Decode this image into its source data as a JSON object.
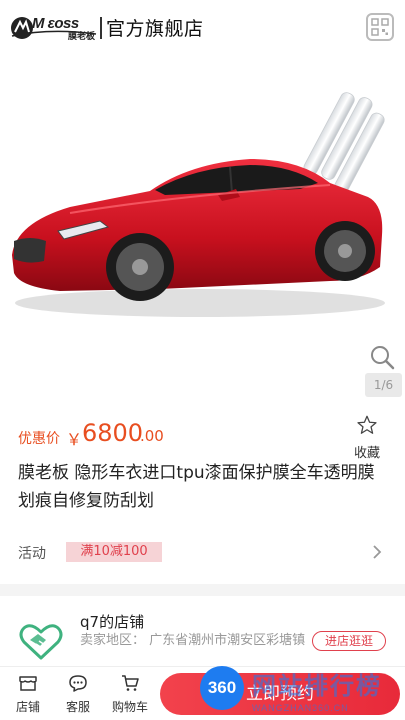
{
  "header": {
    "logo_text": "M ɛoss",
    "logo_sub": "膜老板",
    "title": "官方旗舰店",
    "qr_icon": "qr-code-icon"
  },
  "gallery": {
    "image": "red-sports-car-with-film-rolls",
    "page_indicator": "1/6",
    "zoom_icon": "search-icon"
  },
  "price": {
    "label": "优惠价",
    "currency": "￥",
    "integer": "6800",
    "decimal": ".00",
    "color": "#e84e20"
  },
  "favorite": {
    "label": "收藏",
    "icon": "star-icon"
  },
  "product_title": "膜老板 隐形车衣进口tpu漆面保护膜全车透明膜划痕自修复防刮划",
  "activity": {
    "label": "活动",
    "badge": "满10减100",
    "chevron_icon": "chevron-right-icon"
  },
  "store": {
    "name": "q7的店铺",
    "location": "卖家地区： 广东省潮州市潮安区彩塘镇",
    "visit_label": "进店逛逛",
    "logo_icon": "handshake-heart-icon"
  },
  "bottom_nav": {
    "items": [
      {
        "label": "店铺",
        "icon": "store-icon"
      },
      {
        "label": "客服",
        "icon": "chat-icon"
      },
      {
        "label": "购物车",
        "icon": "cart-icon"
      }
    ],
    "cta_label": "立即预约",
    "accent": "#ea2f3d"
  },
  "watermark": {
    "badge": "360",
    "text": "网站排行榜",
    "sub": "WANGZHAN360.CN"
  }
}
